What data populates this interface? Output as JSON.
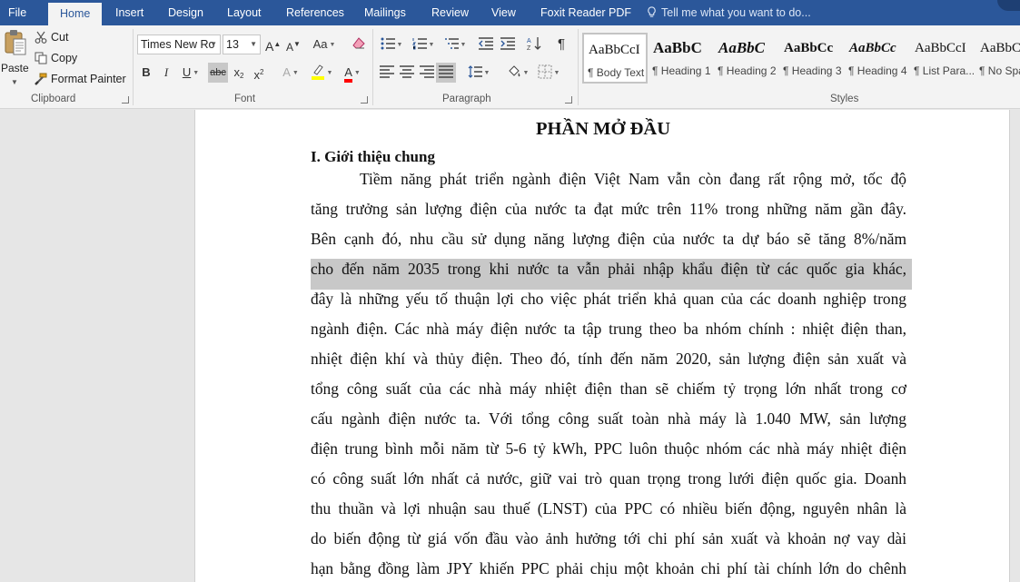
{
  "tabs": {
    "file": "File",
    "home": "Home",
    "insert": "Insert",
    "design": "Design",
    "layout": "Layout",
    "references": "References",
    "mailings": "Mailings",
    "review": "Review",
    "view": "View",
    "foxit": "Foxit Reader PDF",
    "tell_me": "Tell me what you want to do..."
  },
  "clipboard": {
    "paste": "Paste",
    "cut": "Cut",
    "copy": "Copy",
    "format_painter": "Format Painter",
    "group_label": "Clipboard"
  },
  "font": {
    "family": "Times New Ro",
    "size": "13",
    "group_label": "Font",
    "bold": "B",
    "italic": "I",
    "underline": "U",
    "strike": "abc",
    "grow": "A",
    "shrink": "A",
    "case": "Aa",
    "effects": "A",
    "font_color": "A",
    "highlight_color": "#ffff00",
    "text_color": "#ff0000"
  },
  "paragraph": {
    "group_label": "Paragraph",
    "marks": "¶"
  },
  "styles": {
    "group_label": "Styles",
    "items": [
      {
        "sample": "AaBbCcI",
        "name": "¶ Body Text"
      },
      {
        "sample": "AaBbC",
        "name": "¶ Heading 1"
      },
      {
        "sample": "AaBbC",
        "name": "¶ Heading 2"
      },
      {
        "sample": "AaBbCc",
        "name": "¶ Heading 3"
      },
      {
        "sample": "AaBbCc",
        "name": "¶ Heading 4"
      },
      {
        "sample": "AaBbCcI",
        "name": "¶ List Para..."
      },
      {
        "sample": "AaBbC",
        "name": "¶ No Spa"
      }
    ]
  },
  "document": {
    "title": "PHẦN MỞ ĐẦU",
    "heading": "I. Giới thiệu chung",
    "lines": [
      "Tiềm năng phát triển ngành điện Việt Nam vẫn còn đang rất rộng mở, tốc độ",
      "tăng trưởng sản lượng điện của nước ta đạt mức trên 11% trong những năm gần đây.",
      "Bên cạnh đó, nhu cầu sử dụng năng lượng điện của nước ta dự báo sẽ tăng 8%/năm",
      "cho đến năm 2035 trong khi nước ta vẫn phải nhập khẩu điện từ các quốc gia khác,",
      "đây là những yếu tố thuận lợi cho việc phát triển khả quan của các doanh nghiệp trong",
      "ngành điện. Các nhà máy điện nước ta tập trung theo ba nhóm chính : nhiệt điện than,",
      "nhiệt điện khí và thủy điện. Theo đó, tính đến năm 2020, sản lượng điện sản xuất và",
      "tổng công suất của các nhà máy nhiệt điện than sẽ chiếm tỷ trọng lớn nhất trong cơ",
      "cấu ngành điện nước ta. Với tổng công suất toàn nhà máy là 1.040 MW, sản lượng",
      "điện trung bình mỗi năm từ 5-6 tỷ kWh, PPC luôn thuộc nhóm các nhà máy nhiệt điện",
      "có công suất lớn nhất cả nước, giữ vai trò quan trọng trong lưới điện quốc gia. Doanh",
      "thu thuần và lợi nhuận sau thuế (LNST) của PPC có nhiều biến động, nguyên nhân là",
      "do biến động từ giá vốn đầu vào ảnh hưởng tới chi phí sản xuất và khoản nợ vay dài",
      "hạn bằng đồng làm JPY khiến PPC phải chịu một khoản chi phí tài chính lớn do chênh"
    ]
  }
}
